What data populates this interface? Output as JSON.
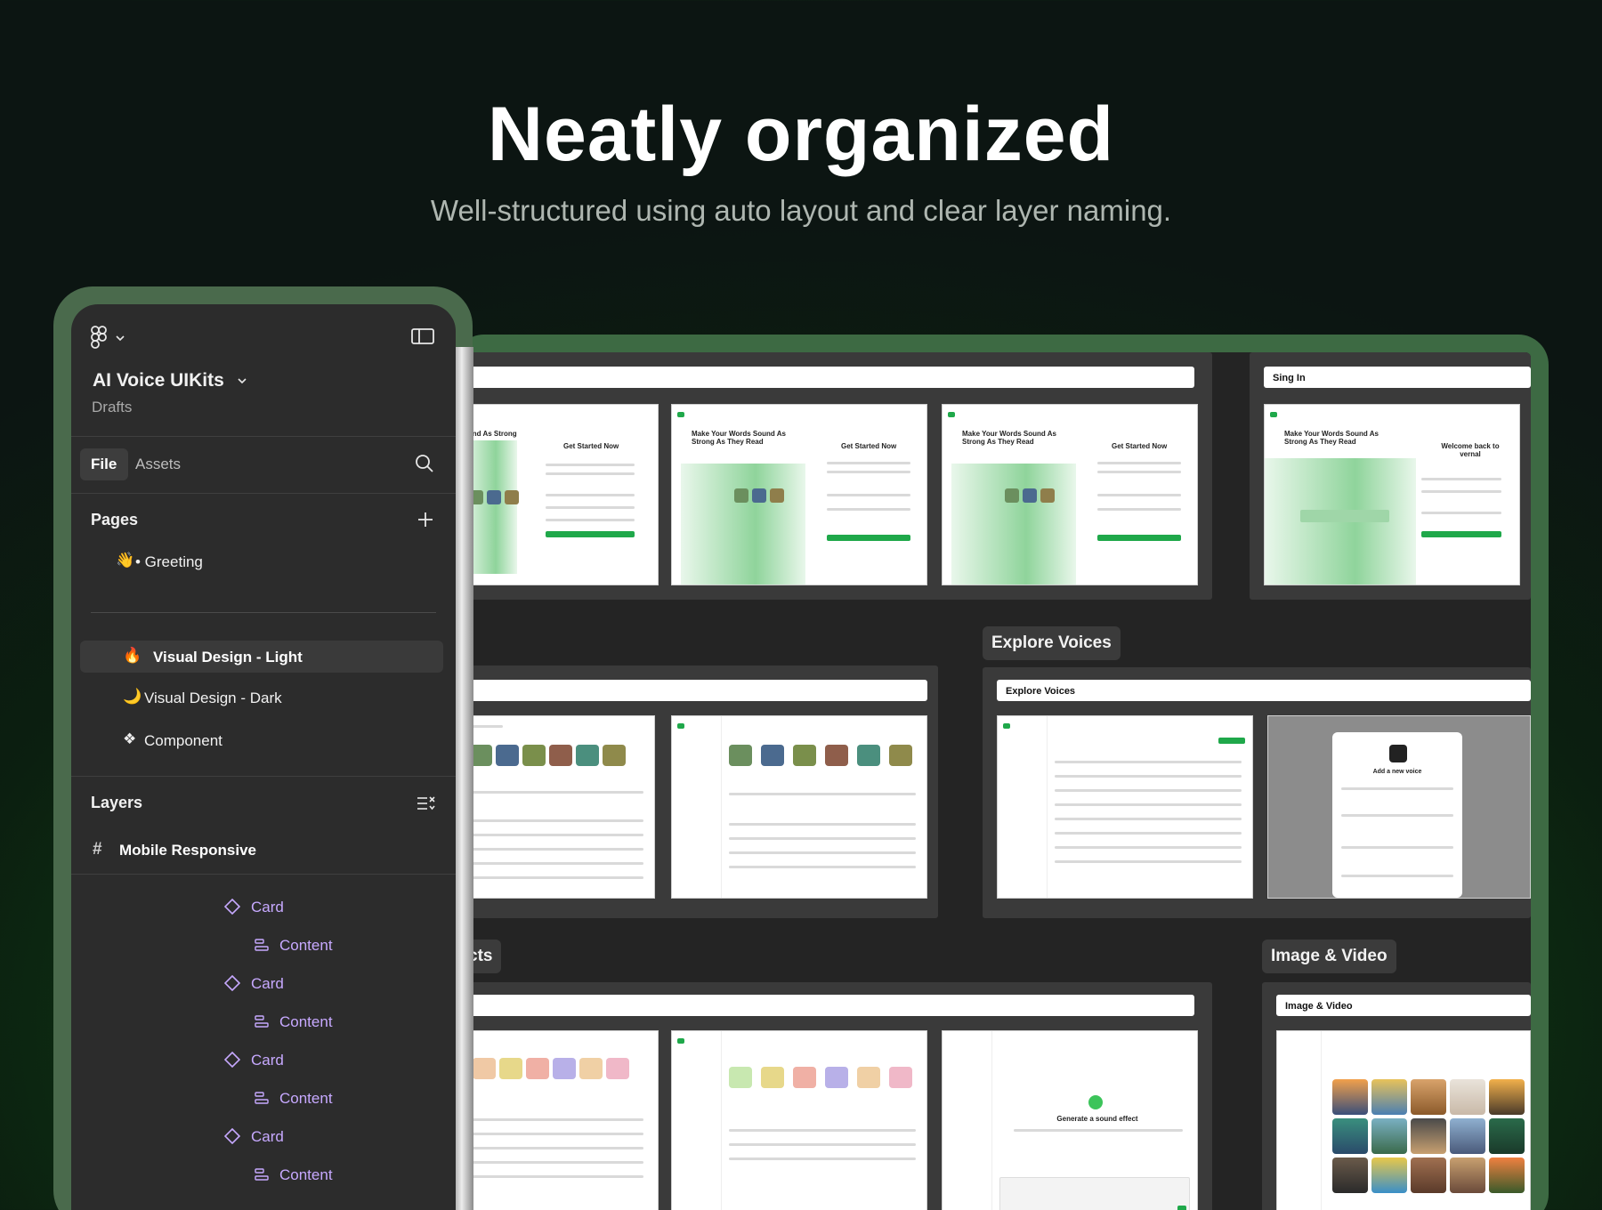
{
  "hero": {
    "title": "Neatly organized",
    "subtitle": "Well-structured using auto layout and clear layer naming."
  },
  "panel": {
    "file_name": "AI Voice UIKits",
    "location": "Drafts",
    "tabs": [
      {
        "label": "File",
        "active": true
      },
      {
        "label": "Assets",
        "active": false
      }
    ],
    "pages_title": "Pages",
    "pages": [
      {
        "emoji": "👋",
        "label": "• Greeting",
        "selected": false
      },
      {
        "emoji": "🔥",
        "label": "Visual Design - Light",
        "selected": true
      },
      {
        "emoji": "🌙",
        "label": "Visual Design - Dark",
        "selected": false
      },
      {
        "emoji": "❖",
        "label": "Component",
        "selected": false
      }
    ],
    "layers_title": "Layers",
    "root_frame": "Mobile Responsive",
    "layers": [
      {
        "type": "component-icon",
        "label": "Card"
      },
      {
        "type": "auto-layout-icon",
        "label": "Content"
      },
      {
        "type": "component-icon",
        "label": "Card"
      },
      {
        "type": "auto-layout-icon",
        "label": "Content"
      },
      {
        "type": "component-icon",
        "label": "Card"
      },
      {
        "type": "auto-layout-icon",
        "label": "Content"
      },
      {
        "type": "component-icon",
        "label": "Card"
      },
      {
        "type": "auto-layout-icon",
        "label": "Content"
      }
    ]
  },
  "canvas": {
    "section_labels": {
      "explore_voices": "Explore Voices",
      "image_video": "Image & Video",
      "sound_effects_fragment": "cts"
    },
    "section_heads": {
      "sign_in": "Sing In",
      "explore_voices": "Explore Voices",
      "image_video": "Image & Video"
    },
    "signup_screens": {
      "headline": "Make Your Words Sound As Strong As They Read",
      "headline_fragment": "ound As Strong",
      "form_title": "Get Started Now",
      "signin_title": "Welcome back to vernal"
    },
    "overlay_modal_title": "Add a new voice",
    "sound_effect_title": "Generate a sound effect"
  },
  "colors": {
    "accent_green": "#1fa84a",
    "panel_bg": "#2c2c2c",
    "layer_purple": "#c7a9ff"
  }
}
